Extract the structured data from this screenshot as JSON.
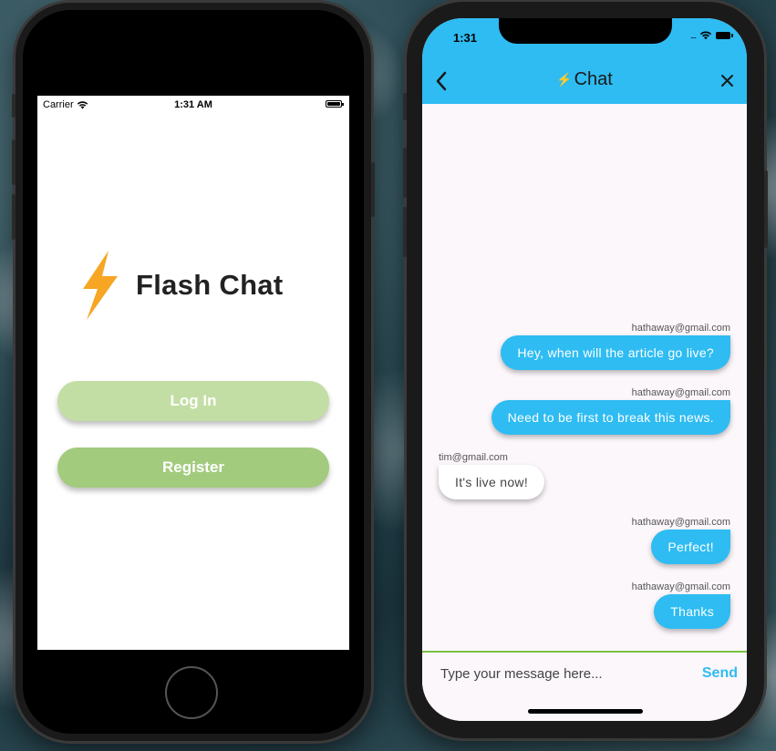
{
  "left_screen": {
    "status_bar": {
      "carrier": "Carrier",
      "time": "1:31 AM"
    },
    "logo_title": "Flash Chat",
    "login_label": "Log In",
    "register_label": "Register"
  },
  "right_screen": {
    "status_bar": {
      "time": "1:31",
      "signal": "...."
    },
    "title": "Chat",
    "title_icon": "⚡",
    "messages": [
      {
        "sender": "hathaway@gmail.com",
        "text": "Hey, when will the article go live?",
        "is_me": true
      },
      {
        "sender": "hathaway@gmail.com",
        "text": "Need to be first to break this news.",
        "is_me": true
      },
      {
        "sender": "tim@gmail.com",
        "text": "It's live now!",
        "is_me": false
      },
      {
        "sender": "hathaway@gmail.com",
        "text": "Perfect!",
        "is_me": true
      },
      {
        "sender": "hathaway@gmail.com",
        "text": "Thanks",
        "is_me": true
      }
    ],
    "composer": {
      "placeholder": "Type your message here...",
      "send_label": "Send"
    }
  },
  "colors": {
    "appbar": "#2ebcf2",
    "my_bubble": "#2ebcf2",
    "login_button": "#c3dea4",
    "register_button": "#a2cb7e",
    "bolt": "#f6a623",
    "composer_divider": "#7ac143"
  },
  "icons": [
    "wifi-icon",
    "battery-icon",
    "bolt-icon",
    "back-chevron-icon",
    "close-icon",
    "home-button"
  ]
}
